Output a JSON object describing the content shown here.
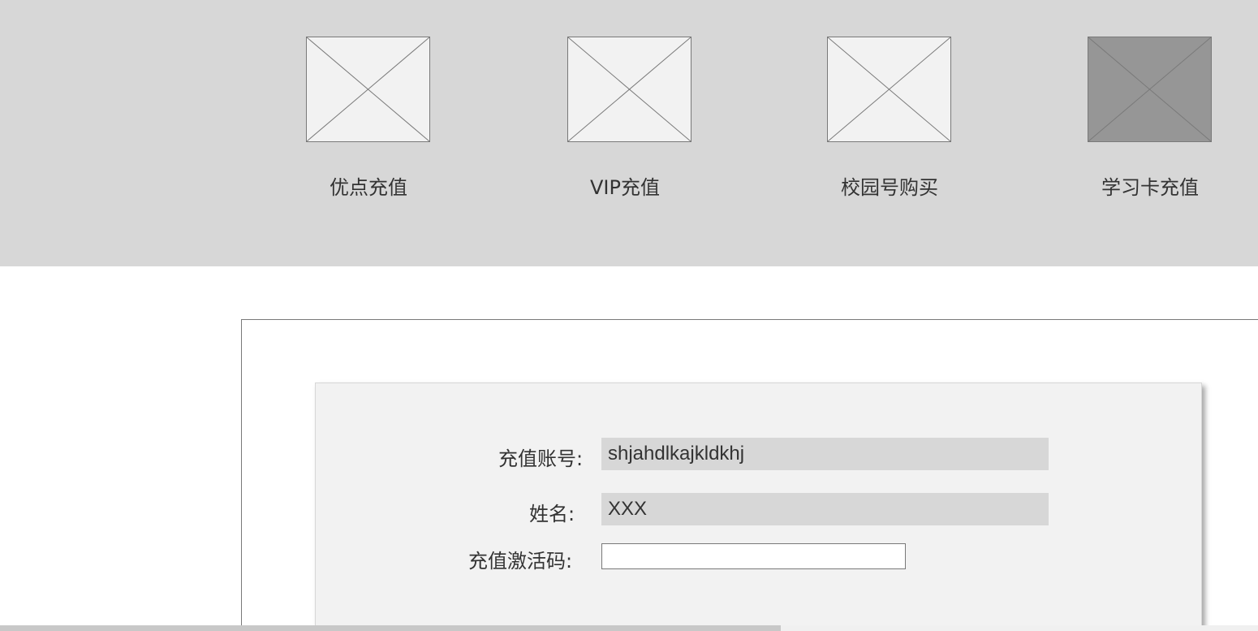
{
  "nav": {
    "items": [
      {
        "label": "优点充值",
        "icon": "placeholder-image-icon",
        "active": false
      },
      {
        "label": "VIP充值",
        "icon": "placeholder-image-icon",
        "active": false
      },
      {
        "label": "校园号购买",
        "icon": "placeholder-image-icon",
        "active": false
      },
      {
        "label": "学习卡充值",
        "icon": "placeholder-image-icon",
        "active": true
      }
    ],
    "background": "#d7d7d7",
    "active_thumb_color": "#969696"
  },
  "form": {
    "account_label": "充值账号:",
    "account_value": "shjahdlkajkldkhj",
    "name_label": "姓名:",
    "name_value": "XXX",
    "code_label": "充值激活码:",
    "code_value": "",
    "code_placeholder": ""
  }
}
